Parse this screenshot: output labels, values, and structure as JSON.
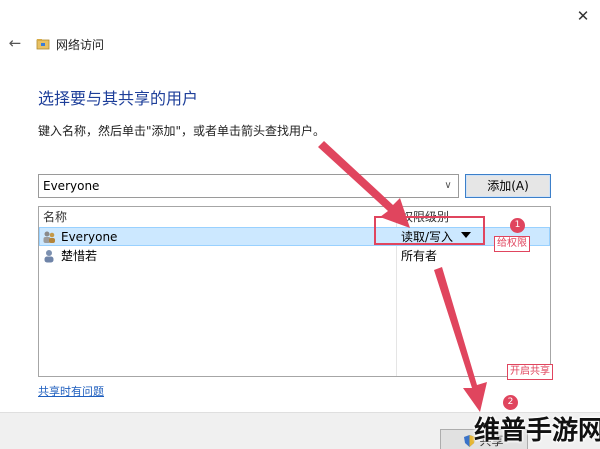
{
  "window": {
    "title": "网络访问",
    "close_glyph": "✕",
    "back_glyph": "←"
  },
  "main": {
    "heading": "选择要与其共享的用户",
    "instruction": "键入名称，然后单击\"添加\"，或者单击箭头查找用户。"
  },
  "picker": {
    "value": "Everyone",
    "add_label": "添加(A)"
  },
  "table": {
    "headers": {
      "name": "名称",
      "level": "权限级别"
    },
    "rows": [
      {
        "name": "Everyone",
        "level": "读取/写入",
        "selected": true
      },
      {
        "name": "楚惜若",
        "level": "所有者",
        "selected": false
      }
    ]
  },
  "link": {
    "trouble": "共享时有问题"
  },
  "footer": {
    "share_label": "共享"
  },
  "annotations": {
    "step1": {
      "badge": "1",
      "label": "给权限"
    },
    "step2": {
      "badge": "2",
      "label": "开启共享"
    },
    "color": "#e0455e"
  },
  "watermark": "维普手游网",
  "colors": {
    "heading": "#1e3f9a",
    "link": "#1f5fbf",
    "selection": "#cce8ff"
  }
}
